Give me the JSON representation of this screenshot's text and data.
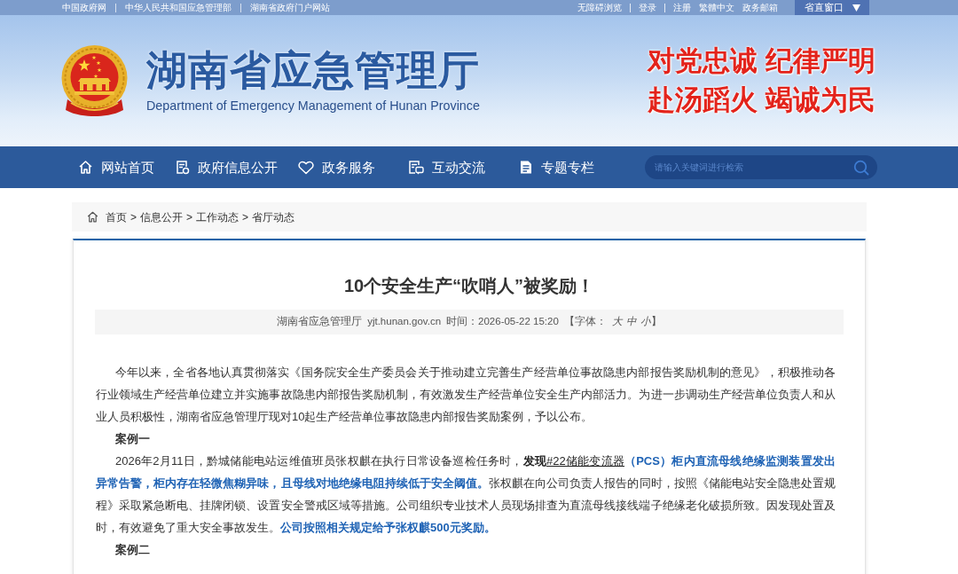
{
  "top_bar": {
    "left_links": [
      "中国政府网",
      "中华人民共和国应急管理部",
      "湖南省政府门户网站"
    ],
    "right_link_groups": [
      [
        "无障碍浏览"
      ],
      [
        "登录"
      ],
      [
        "注册",
        "繁體中文",
        "政务邮箱"
      ]
    ],
    "window_button": "省直窗口"
  },
  "header": {
    "title": "湖南省应急管理厅",
    "subtitle": "Department of Emergency Management of Hunan Province",
    "slogans": [
      "对党忠诚 纪律严明",
      "赴汤蹈火 竭诚为民"
    ]
  },
  "nav": {
    "items": [
      {
        "label": "网站首页"
      },
      {
        "label": "政府信息公开"
      },
      {
        "label": "政务服务"
      },
      {
        "label": "互动交流"
      },
      {
        "label": "专题专栏"
      }
    ],
    "search": {
      "placeholder": "请输入关键词进行检索"
    }
  },
  "breadcrumb": {
    "items": [
      "首页",
      "信息公开",
      "工作动态",
      "省厅动态"
    ],
    "separator": ">"
  },
  "article": {
    "title": "10个安全生产“吹哨人”被奖励！",
    "meta": {
      "source": "湖南省应急管理厅",
      "site": "yjt.hunan.gov.cn",
      "time": "时间：2026-05-22 15:20",
      "font_label": "【字体：",
      "font_sizes": [
        "大",
        "中",
        "小"
      ],
      "font_close": "】"
    },
    "body": [
      {
        "kind": "paragraph",
        "segments": [
          {
            "kind": "plain",
            "text": "今年以来，全省各地认真贯彻落实《国务院安全生产委员会关于推动建立完善生产经营单位事故隐患内部报告奖励机制的意见》，积极推动各行业领域生产经营单位建立并实施事故隐患内部报告奖励机制，有效激发生产经营单位安全生产内部活力。为进一步调动生产经营单位负责人和从业人员积极性，湖南省应急管理厅现对10起生产经营单位事故隐患内部报告奖励案例，予以公布。"
          }
        ]
      },
      {
        "kind": "heading",
        "text": "案例一"
      },
      {
        "kind": "paragraph",
        "segments": [
          {
            "kind": "plain",
            "text": "2026年2月11日，黔城储能电站运维值班员张权麒在执行日常设备巡检任务时，"
          },
          {
            "kind": "bold",
            "text": "发现"
          },
          {
            "kind": "link",
            "text": "#22储能变流器"
          },
          {
            "kind": "highlight",
            "text": "（PCS）柜内直流母线绝缘监测装置发出异常告警，柜内存在轻微焦糊异味，且母线对地绝缘电阻持续低于安全阈值。"
          },
          {
            "kind": "plain",
            "text": "张权麒在向公司负责人报告的同时，按照《储能电站安全隐患处置规程》采取紧急断电、挂牌闭锁、设置安全警戒区域等措施。公司组织专业技术人员现场排查为直流母线接线端子绝缘老化破损所致。因发现处置及时，有效避免了重大安全事故发生。"
          },
          {
            "kind": "highlight",
            "text": "公司按照相关规定给予张权麒500元奖励。"
          }
        ]
      },
      {
        "kind": "heading",
        "text": "案例二"
      }
    ]
  }
}
